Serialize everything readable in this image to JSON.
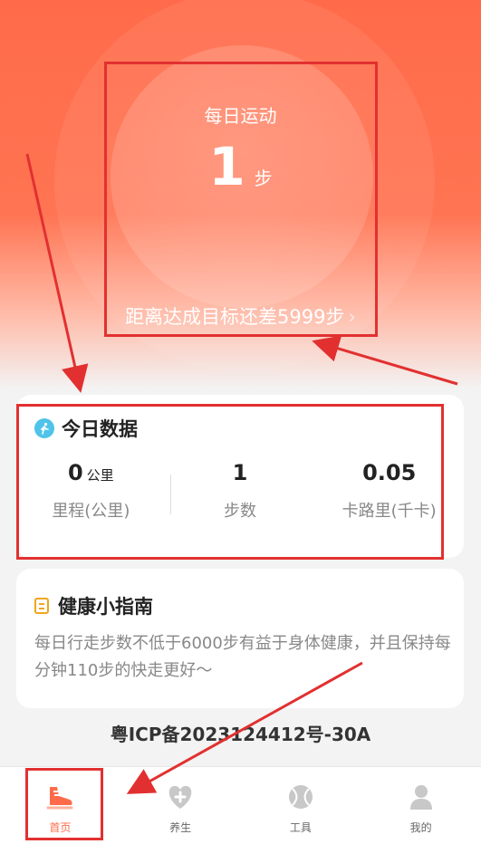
{
  "hero": {
    "title": "每日运动",
    "steps": "1",
    "unit": "步",
    "goal_text": "距离达成目标还差5999步",
    "chevron": "›"
  },
  "today": {
    "title": "今日数据",
    "stats": [
      {
        "value": "0",
        "unit": "公里",
        "label": "里程(公里)"
      },
      {
        "value": "1",
        "unit": "",
        "label": "步数"
      },
      {
        "value": "0.05",
        "unit": "",
        "label": "卡路里(千卡)"
      }
    ]
  },
  "guide": {
    "title": "健康小指南",
    "text": "每日行走步数不低于6000步有益于身体健康，并且保持每分钟110步的快走更好～"
  },
  "footer": {
    "icp": "粤ICP备2023124412号-30A"
  },
  "tabs": [
    {
      "label": "首页",
      "icon": "shoe-icon",
      "active": true
    },
    {
      "label": "养生",
      "icon": "heart-plus-icon",
      "active": false
    },
    {
      "label": "工具",
      "icon": "ball-icon",
      "active": false
    },
    {
      "label": "我的",
      "icon": "user-icon",
      "active": false
    }
  ],
  "colors": {
    "accent": "#ff6b4a",
    "highlight": "#e23030",
    "info": "#4fc3e9",
    "warning": "#f0a61c"
  }
}
